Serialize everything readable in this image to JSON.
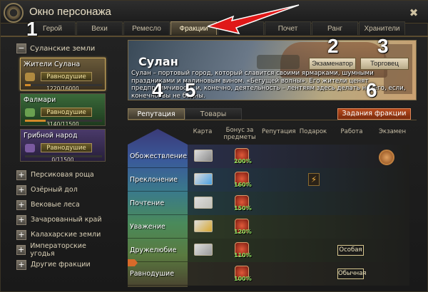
{
  "window": {
    "title": "Окно персонажа"
  },
  "tabs": [
    "Герой",
    "Вехи",
    "Ремесло",
    "Фракции",
    "",
    "Почет",
    "Ранг",
    "Хранители"
  ],
  "annotations": [
    "1",
    "2",
    "3",
    "4",
    "5",
    "6"
  ],
  "left": {
    "group_title": "Суланские земли",
    "factions": [
      {
        "name": "Жители Сулана",
        "status": "Равнодушие",
        "progress_text": "1220/16000",
        "progress": 0.076,
        "color": "#b08a40"
      },
      {
        "name": "Фалмари",
        "status": "Равнодушие",
        "progress_text": "3140/11500",
        "progress": 0.27,
        "color": "#6aa050"
      },
      {
        "name": "Грибной народ",
        "status": "Равнодушие",
        "progress_text": "0/11500",
        "progress": 0.0,
        "color": "#7a5aa0"
      }
    ],
    "locations": [
      "Персиковая роща",
      "Озёрный дол",
      "Вековые леса",
      "Зачарованный край",
      "Калахарские земли",
      "Императорские угодья",
      "Другие фракции"
    ]
  },
  "banner": {
    "title": "Сулан",
    "description": "Сулан – портовый город, который славится своими ярмарками, шумными праздниками и малиновым вином. «Бегущей волны». Его жители ценят предприимчивость и, конечно, деятельность – лентяям здесь делать нечего, если, конечно, вы не бедны.",
    "examiner_label": "Экзаменатор",
    "merchant_label": "Торговец"
  },
  "subtabs": [
    "Репутация",
    "Товары"
  ],
  "quest_button": "Задания фракции",
  "columns": [
    "Карта",
    "Бонус за предметы",
    "Репутация",
    "Подарок",
    "Работа",
    "Экзамен"
  ],
  "ranks": [
    {
      "name": "Обожествление",
      "bonus": "200%",
      "card_color": "#8a8a8a",
      "bg": "#2a2f4a",
      "exam": true
    },
    {
      "name": "Преклонение",
      "bonus": "160%",
      "card_color": "#4aa0e0",
      "bg": "#23384a",
      "gift": "⚡"
    },
    {
      "name": "Почтение",
      "bonus": "150%",
      "card_color": "#c0c0b8",
      "bg": "#233a3e"
    },
    {
      "name": "Уважение",
      "bonus": "120%",
      "card_color": "#d8a830",
      "bg": "#2e3a26"
    },
    {
      "name": "Дружелюбие",
      "bonus": "110%",
      "card_color": "#9a9a9a",
      "bg": "#2a3422",
      "work": "Особая"
    },
    {
      "name": "Равнодушие",
      "bonus": "100%",
      "bg": "#2c2a22",
      "work": "Обычная"
    }
  ],
  "colors": {
    "accent": "#d28a2a",
    "active_tab": "#5c5340",
    "quest_button": "#b84a1c"
  }
}
